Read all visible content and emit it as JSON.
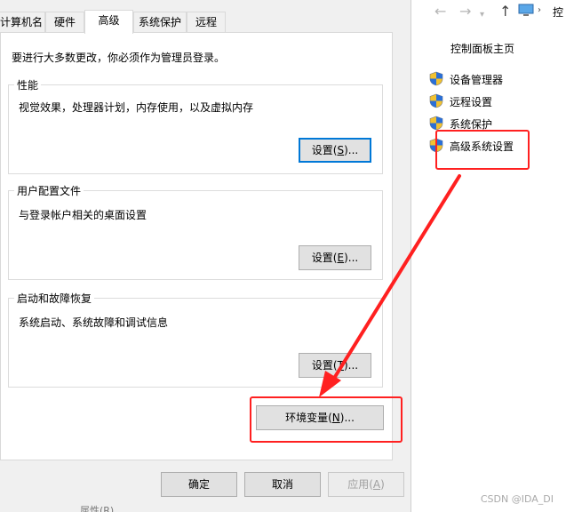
{
  "tabs": [
    "计算机名",
    "硬件",
    "高级",
    "系统保护",
    "远程"
  ],
  "notice": "要进行大多数更改，你必须作为管理员登录。",
  "performance": {
    "title": "性能",
    "desc": "视觉效果，处理器计划，内存使用，以及虚拟内存",
    "button": {
      "label": "设置(",
      "key": "S",
      "suffix": ")..."
    }
  },
  "user_profiles": {
    "title": "用户配置文件",
    "desc": "与登录帐户相关的桌面设置",
    "button": {
      "label": "设置(",
      "key": "E",
      "suffix": ")..."
    }
  },
  "startup": {
    "title": "启动和故障恢复",
    "desc": "系统启动、系统故障和调试信息",
    "button": {
      "label": "设置(",
      "key": "T",
      "suffix": ")..."
    }
  },
  "env_button": {
    "label": "环境变量(",
    "key": "N",
    "suffix": ")..."
  },
  "footer": {
    "ok": "确定",
    "cancel": "取消",
    "apply": {
      "label": "应用(",
      "key": "A",
      "suffix": ")"
    }
  },
  "control_panel": {
    "address": "控",
    "home": "控制面板主页",
    "links": [
      "设备管理器",
      "远程设置",
      "系统保护",
      "高级系统设置"
    ]
  },
  "annotation_color": "#ff2020",
  "watermark": "CSDN @IDA_DI",
  "cut_text": "属性(R)"
}
